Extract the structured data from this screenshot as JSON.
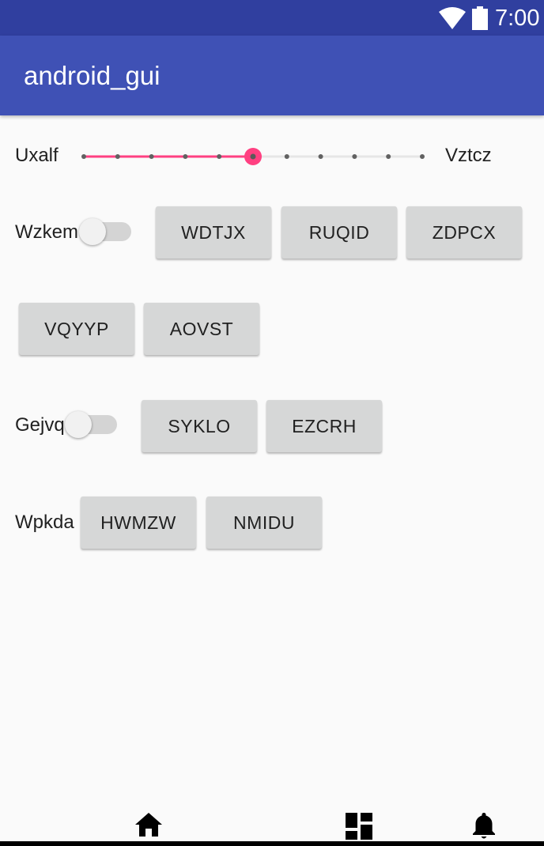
{
  "status_bar": {
    "time": "7:00",
    "icons": [
      "wifi-icon",
      "battery-icon"
    ],
    "color": "#303f9f"
  },
  "app_bar": {
    "title": "android_gui",
    "color": "#3f51b5"
  },
  "slider_row": {
    "left_label": "Uxalf",
    "right_label": "Vztcz",
    "steps": 10,
    "value": 5,
    "accent_color": "#ff4081"
  },
  "row1": {
    "label": "Wzkem",
    "switch_on": false,
    "buttons": [
      "WDTJX",
      "RUQID",
      "ZDPCX"
    ]
  },
  "row2": {
    "buttons": [
      "VQYYP",
      "AOVST"
    ]
  },
  "row3": {
    "label": "Gejvq",
    "switch_on": false,
    "buttons": [
      "SYKLO",
      "EZCRH"
    ]
  },
  "row4": {
    "label": "Wpkda",
    "buttons": [
      "HWMZW",
      "NMIDU"
    ]
  },
  "bottom_nav": {
    "items": [
      "home-icon",
      "dashboard-icon",
      "notifications-icon"
    ]
  }
}
